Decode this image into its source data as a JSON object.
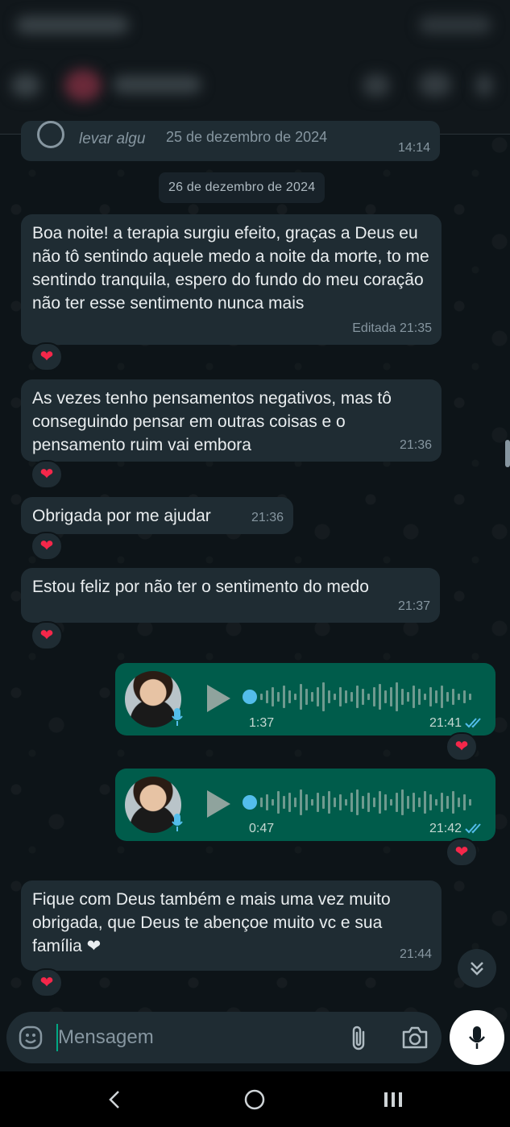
{
  "previous_message": {
    "text": "levar algu",
    "date_overlay": "25 de dezembro de 2024",
    "time": "14:14"
  },
  "date_separator": "26 de dezembro de 2024",
  "messages": [
    {
      "text": "Boa noite! a terapia surgiu efeito, graças a Deus eu não tô sentindo aquele medo a noite da morte, to me sentindo tranquila, espero do fundo do meu coração  não ter esse sentimento nunca mais",
      "meta": "Editada 21:35",
      "reaction": "❤"
    },
    {
      "text": "As vezes tenho pensamentos negativos, mas tô conseguindo pensar em outras coisas e o pensamento ruim vai embora",
      "meta": "21:36",
      "reaction": "❤"
    },
    {
      "text": "Obrigada por me ajudar",
      "meta": "21:36",
      "reaction": "❤"
    },
    {
      "text": "Estou feliz por não ter o sentimento do medo",
      "meta": "21:37",
      "reaction": "❤"
    },
    {
      "text": "Fique com Deus também e mais uma vez muito obrigada, que Deus te abençoe muito vc e sua família ❤",
      "meta": "21:44",
      "reaction": "❤"
    }
  ],
  "voice_messages": [
    {
      "duration": "1:37",
      "time": "21:41",
      "reaction": "❤"
    },
    {
      "duration": "0:47",
      "time": "21:42",
      "reaction": "❤"
    }
  ],
  "composer": {
    "placeholder": "Mensagem"
  },
  "colors": {
    "incoming_bubble": "#1f2c33",
    "outgoing_bubble": "#005c4b",
    "read_ticks": "#53bdeb",
    "heart": "#f5274a"
  },
  "icons": [
    "emoji-icon",
    "attach-icon",
    "camera-icon",
    "mic-icon",
    "play-icon",
    "double-check-icon",
    "chevron-double-down-icon",
    "nav-back-icon",
    "nav-home-icon",
    "nav-recents-icon"
  ]
}
